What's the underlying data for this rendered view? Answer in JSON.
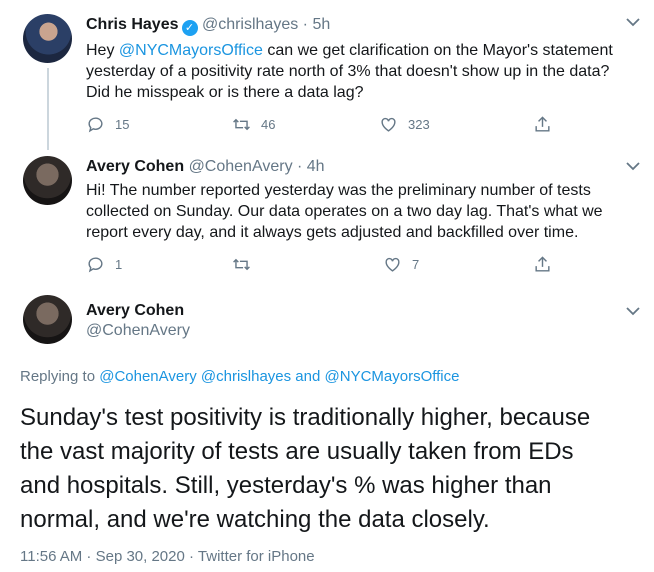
{
  "tweet1": {
    "name": "Chris Hayes",
    "handle": "@chrislhayes",
    "time": "5h",
    "text_pre": "Hey ",
    "mention": "@NYCMayorsOffice",
    "text_line1_post": " can we get clarification on the Mayor's statement",
    "text_line2": "yesterday of a positivity rate north of 3% that doesn't show up in the data?",
    "text_line3": "Did he misspeak or is there a data lag?",
    "replies": "15",
    "retweets": "46",
    "likes": "323"
  },
  "tweet2": {
    "name": "Avery Cohen",
    "handle": "@CohenAvery",
    "time": "4h",
    "line1": "Hi! The number reported yesterday was the preliminary number of tests",
    "line2": "collected on Sunday. Our data operates on a two day lag. That's what we",
    "line3": "report every day, and it always gets adjusted and backfilled over time.",
    "replies": "1",
    "retweets": "",
    "likes": "7"
  },
  "main": {
    "name": "Avery Cohen",
    "handle": "@CohenAvery",
    "replying_prefix": "Replying to",
    "replying_to": "@CohenAvery @chrislhayes and @NYCMayorsOffice",
    "line1": "Sunday's test positivity is traditionally higher, because",
    "line2": "the vast majority of tests are usually taken from EDs",
    "line3": "and hospitals. Still, yesterday's % was higher than",
    "line4": "normal, and we're watching the data closely.",
    "timestamp": "11:56 AM · Sep 30, 2020 · Twitter for iPhone"
  },
  "separator": " · ",
  "icons": [
    "verified-icon",
    "chevron-down-icon",
    "reply-icon",
    "retweet-icon",
    "like-icon",
    "share-icon"
  ],
  "colors": {
    "link": "#1b95e0",
    "muted": "#657786",
    "verified": "#1da1f2"
  }
}
